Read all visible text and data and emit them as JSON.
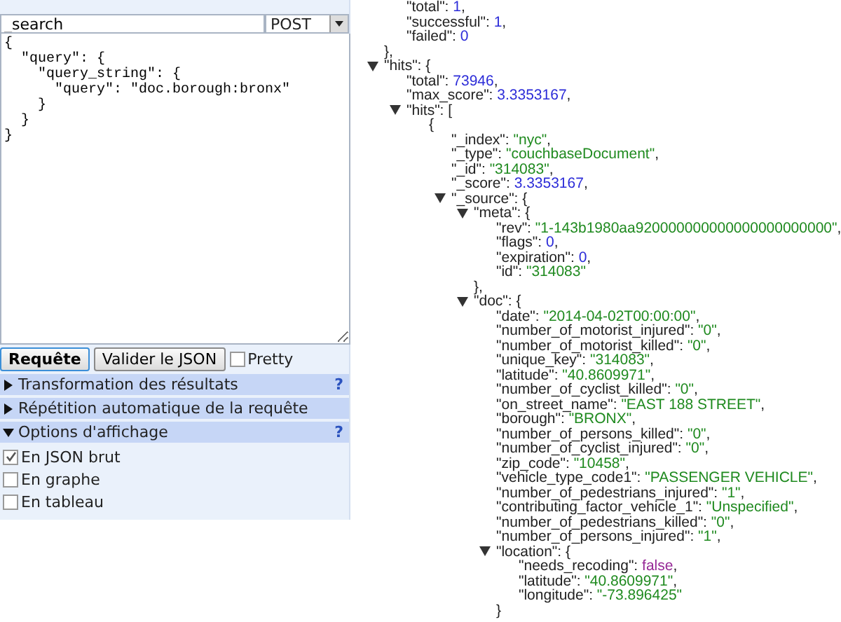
{
  "request": {
    "path": "_search",
    "method": "POST",
    "body": "{\n  \"query\": {\n    \"query_string\": {\n      \"query\": \"doc.borough:bronx\"\n    }\n  }\n}"
  },
  "buttons": [
    {
      "label": "Requête",
      "focused": true
    },
    {
      "label": "Valider le JSON",
      "focused": false
    }
  ],
  "pretty": {
    "label": "Pretty",
    "checked": false
  },
  "sections": [
    {
      "title": "Transformation des résultats",
      "expanded": false,
      "help": "?"
    },
    {
      "title": "Répétition automatique de la requête",
      "expanded": false
    },
    {
      "title": "Options d'affichage",
      "expanded": true,
      "help": "?"
    }
  ],
  "display_options": [
    {
      "label": "En JSON brut",
      "checked": true
    },
    {
      "label": "En graphe",
      "checked": false
    },
    {
      "label": "En tableau",
      "checked": false
    }
  ],
  "tree": [
    {
      "children": [
        {
          "key": "\"total\":",
          "value": "1",
          "kind": "number",
          "after": ","
        },
        {
          "key": "\"successful\":",
          "value": "1",
          "kind": "number",
          "after": ","
        },
        {
          "key": "\"failed\":",
          "value": "0",
          "kind": "number"
        }
      ],
      "close": "},"
    },
    {
      "key": "\"hits\":",
      "open": "{",
      "expanded": true,
      "children": [
        {
          "key": "\"total\":",
          "value": "73946",
          "kind": "number",
          "after": ","
        },
        {
          "key": "\"max_score\":",
          "value": "3.3353167",
          "kind": "number",
          "after": ","
        },
        {
          "key": "\"hits\":",
          "open": "[",
          "expanded": true,
          "children": [
            {
              "open": "{",
              "children": [
                {
                  "key": "\"_index\":",
                  "value": "\"nyc\"",
                  "kind": "string",
                  "after": ","
                },
                {
                  "key": "\"_type\":",
                  "value": "\"couchbaseDocument\"",
                  "kind": "string",
                  "after": ","
                },
                {
                  "key": "\"_id\":",
                  "value": "\"314083\"",
                  "kind": "string",
                  "after": ","
                },
                {
                  "key": "\"_score\":",
                  "value": "3.3353167",
                  "kind": "number",
                  "after": ","
                },
                {
                  "key": "\"_source\":",
                  "open": "{",
                  "expanded": true,
                  "children": [
                    {
                      "key": "\"meta\":",
                      "open": "{",
                      "expanded": true,
                      "close": "},",
                      "children": [
                        {
                          "key": "\"rev\":",
                          "value": "\"1-143b1980aa920000000000000000000000\"",
                          "kind": "string",
                          "after": ","
                        },
                        {
                          "key": "\"flags\":",
                          "value": "0",
                          "kind": "number",
                          "after": ","
                        },
                        {
                          "key": "\"expiration\":",
                          "value": "0",
                          "kind": "number",
                          "after": ","
                        },
                        {
                          "key": "\"id\":",
                          "value": "\"314083\"",
                          "kind": "string"
                        }
                      ]
                    },
                    {
                      "key": "\"doc\":",
                      "open": "{",
                      "expanded": true,
                      "children": [
                        {
                          "key": "\"date\":",
                          "value": "\"2014-04-02T00:00:00\"",
                          "kind": "string",
                          "after": ","
                        },
                        {
                          "key": "\"number_of_motorist_injured\":",
                          "value": "\"0\"",
                          "kind": "string",
                          "after": ","
                        },
                        {
                          "key": "\"number_of_motorist_killed\":",
                          "value": "\"0\"",
                          "kind": "string",
                          "after": ","
                        },
                        {
                          "key": "\"unique_key\":",
                          "value": "\"314083\"",
                          "kind": "string",
                          "after": ","
                        },
                        {
                          "key": "\"latitude\":",
                          "value": "\"40.8609971\"",
                          "kind": "string",
                          "after": ","
                        },
                        {
                          "key": "\"number_of_cyclist_killed\":",
                          "value": "\"0\"",
                          "kind": "string",
                          "after": ","
                        },
                        {
                          "key": "\"on_street_name\":",
                          "value": "\"EAST 188 STREET\"",
                          "kind": "string",
                          "after": ","
                        },
                        {
                          "key": "\"borough\":",
                          "value": "\"BRONX\"",
                          "kind": "string",
                          "after": ","
                        },
                        {
                          "key": "\"number_of_persons_killed\":",
                          "value": "\"0\"",
                          "kind": "string",
                          "after": ","
                        },
                        {
                          "key": "\"number_of_cyclist_injured\":",
                          "value": "\"0\"",
                          "kind": "string",
                          "after": ","
                        },
                        {
                          "key": "\"zip_code\":",
                          "value": "\"10458\"",
                          "kind": "string",
                          "after": ","
                        },
                        {
                          "key": "\"vehicle_type_code1\":",
                          "value": "\"PASSENGER VEHICLE\"",
                          "kind": "string",
                          "after": ","
                        },
                        {
                          "key": "\"number_of_pedestrians_injured\":",
                          "value": "\"1\"",
                          "kind": "string",
                          "after": ","
                        },
                        {
                          "key": "\"contributing_factor_vehicle_1\":",
                          "value": "\"Unspecified\"",
                          "kind": "string",
                          "after": ","
                        },
                        {
                          "key": "\"number_of_pedestrians_killed\":",
                          "value": "\"0\"",
                          "kind": "string",
                          "after": ","
                        },
                        {
                          "key": "\"number_of_persons_injured\":",
                          "value": "\"1\"",
                          "kind": "string",
                          "after": ","
                        },
                        {
                          "key": "\"location\":",
                          "open": "{",
                          "expanded": true,
                          "close": "}",
                          "children": [
                            {
                              "key": "\"needs_recoding\":",
                              "value": "false",
                              "kind": "bool",
                              "after": ","
                            },
                            {
                              "key": "\"latitude\":",
                              "value": "\"40.8609971\"",
                              "kind": "string",
                              "after": ","
                            },
                            {
                              "key": "\"longitude\":",
                              "value": "\"-73.896425\"",
                              "kind": "string"
                            }
                          ]
                        }
                      ]
                    }
                  ]
                }
              ]
            }
          ]
        }
      ]
    }
  ]
}
